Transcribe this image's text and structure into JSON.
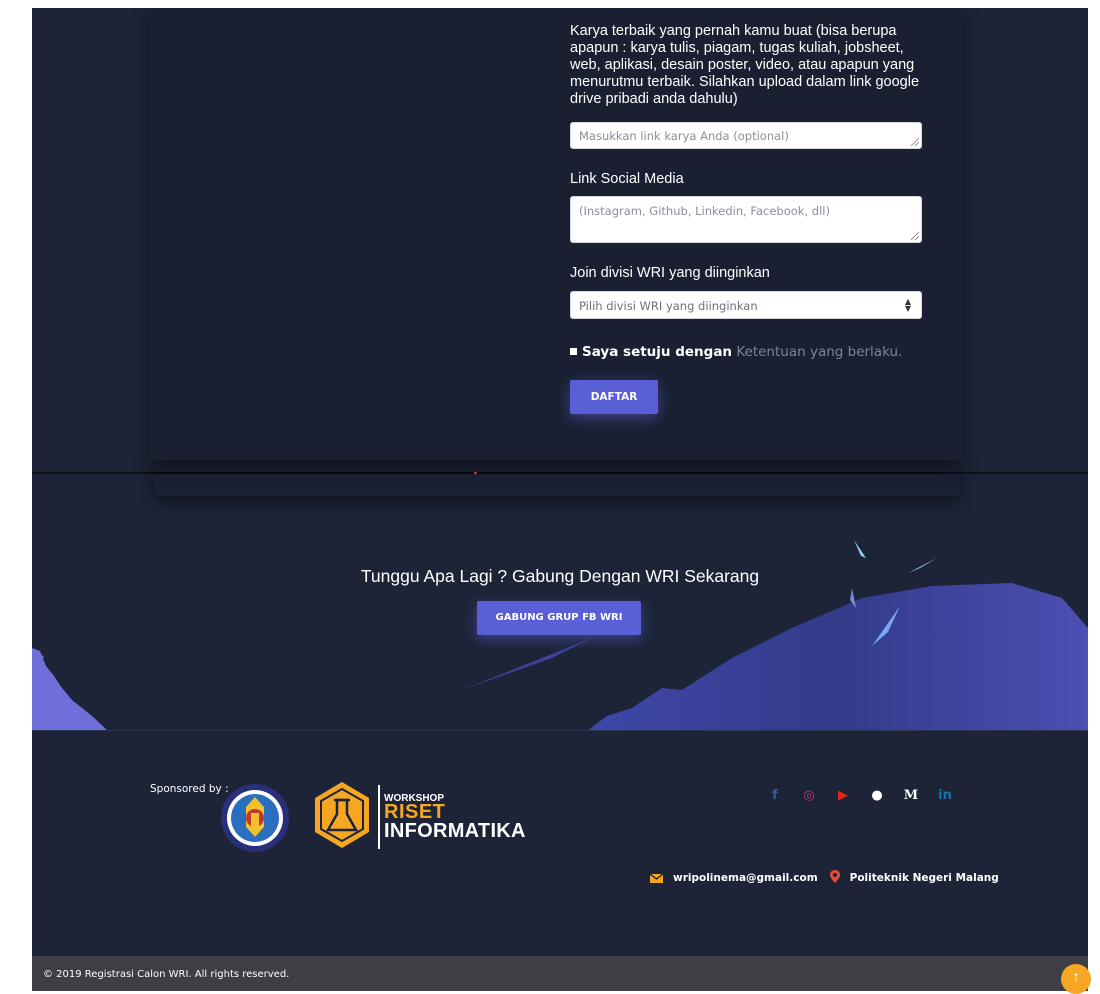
{
  "form": {
    "karya_label": "Karya terbaik yang pernah kamu buat (bisa berupa apapun : karya tulis, piagam, tugas kuliah, jobsheet, web, aplikasi, desain poster, video, atau apapun yang menurutmu terbaik. Silahkan upload dalam link google drive pribadi anda dahulu)",
    "karya_placeholder": "Masukkan link karya Anda (optional)",
    "social_label": "Link Social Media",
    "social_placeholder": "(Instagram, Github, Linkedin, Facebook, dll)",
    "divisi_label": "Join divisi WRI yang diinginkan",
    "divisi_selected": "Pilih divisi WRI yang diinginkan",
    "agree_text": "Saya setuju dengan",
    "agree_link": "Ketentuan yang berlaku.",
    "submit_label": "DAFTAR"
  },
  "cta": {
    "title": "Tunggu Apa Lagi ? Gabung Dengan WRI Sekarang",
    "button_label": "GABUNG GRUP FB WRI"
  },
  "footer": {
    "sponsored_label": "Sponsored by :",
    "wri_logo": {
      "line1": "WORKSHOP",
      "line2": "RISET",
      "line3": "INFORMATIKA"
    },
    "socials": [
      {
        "icon": "facebook-icon",
        "glyph": "f",
        "color": "#3b5998"
      },
      {
        "icon": "instagram-icon",
        "glyph": "◎",
        "color": "#c13584"
      },
      {
        "icon": "youtube-icon",
        "glyph": "▶",
        "color": "#e62117"
      },
      {
        "icon": "github-icon",
        "glyph": "●",
        "color": "#ffffff"
      },
      {
        "icon": "medium-icon",
        "glyph": "M",
        "color": "#ffffff"
      },
      {
        "icon": "linkedin-icon",
        "glyph": "in",
        "color": "#0e76a8"
      }
    ],
    "email": "wripolinema@gmail.com",
    "location": "Politeknik Negeri Malang",
    "copyright": "© 2019 Registrasi Calon WRI. All rights reserved."
  },
  "colors": {
    "accent": "#5a5fd6",
    "background": "#1d2437",
    "email_icon": "#f6a623",
    "location_icon": "#e84a3a",
    "to_top": "#f6a623"
  }
}
